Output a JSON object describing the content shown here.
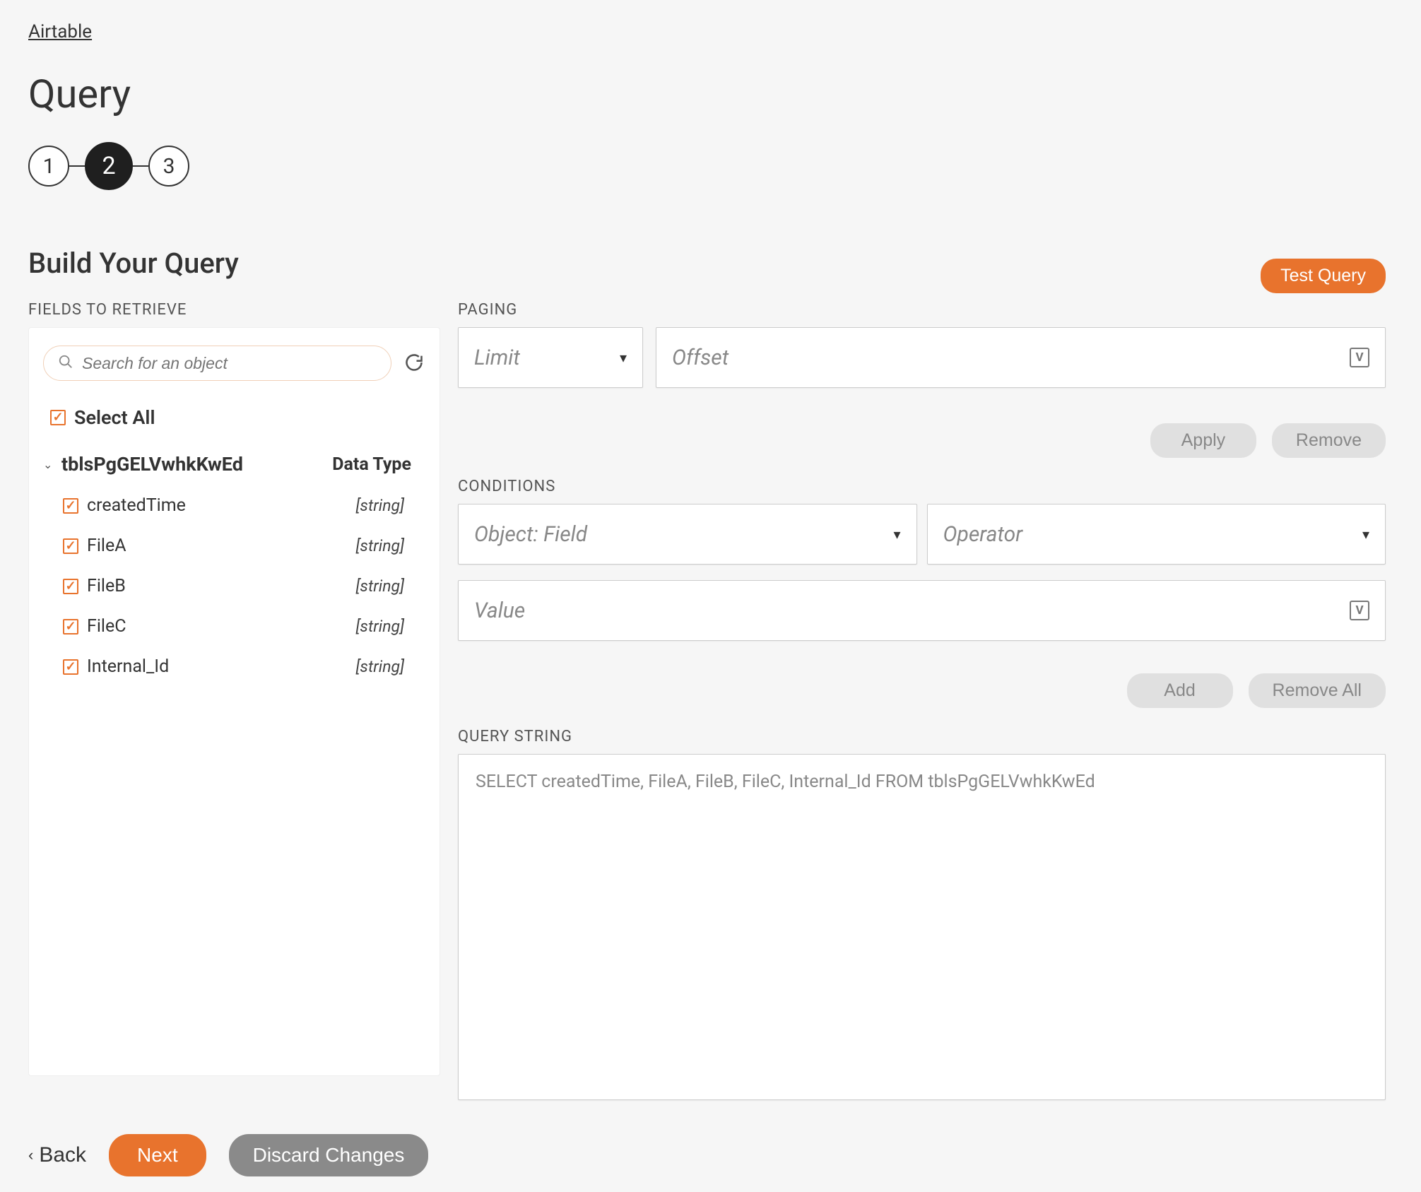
{
  "breadcrumb": "Airtable",
  "page_title": "Query",
  "stepper": {
    "steps": [
      "1",
      "2",
      "3"
    ],
    "active_index": 1
  },
  "section_title": "Build Your Query",
  "fields_panel": {
    "label": "FIELDS TO RETRIEVE",
    "search_placeholder": "Search for an object",
    "select_all_label": "Select All",
    "select_all_checked": true,
    "table_name": "tblsPgGELVwhkKwEd",
    "data_type_header": "Data Type",
    "fields": [
      {
        "name": "createdTime",
        "type": "[string]",
        "checked": true
      },
      {
        "name": "FileA",
        "type": "[string]",
        "checked": true
      },
      {
        "name": "FileB",
        "type": "[string]",
        "checked": true
      },
      {
        "name": "FileC",
        "type": "[string]",
        "checked": true
      },
      {
        "name": "Internal_Id",
        "type": "[string]",
        "checked": true
      }
    ]
  },
  "test_query_label": "Test Query",
  "paging": {
    "label": "PAGING",
    "limit_placeholder": "Limit",
    "offset_placeholder": "Offset"
  },
  "paging_buttons": {
    "apply": "Apply",
    "remove": "Remove"
  },
  "conditions": {
    "label": "CONDITIONS",
    "object_field_placeholder": "Object: Field",
    "operator_placeholder": "Operator",
    "value_placeholder": "Value"
  },
  "conditions_buttons": {
    "add": "Add",
    "remove_all": "Remove All"
  },
  "query_string": {
    "label": "QUERY STRING",
    "value": "SELECT createdTime, FileA, FileB, FileC, Internal_Id FROM tblsPgGELVwhkKwEd"
  },
  "footer": {
    "back": "Back",
    "next": "Next",
    "discard": "Discard Changes"
  },
  "v_chip": "V"
}
